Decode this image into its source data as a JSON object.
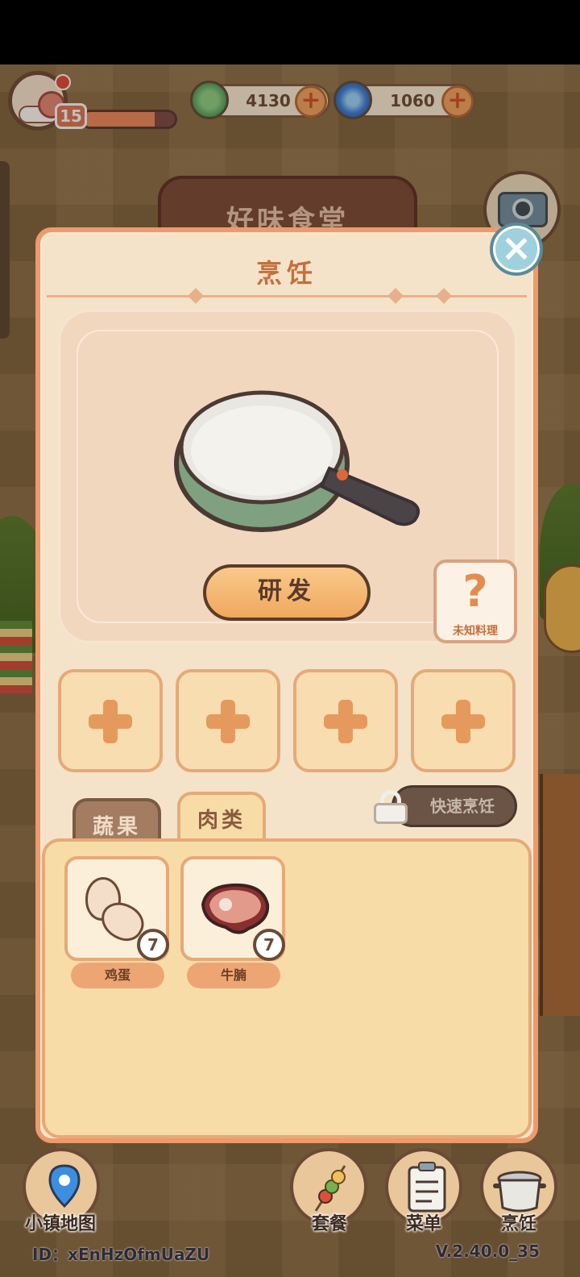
{
  "hud": {
    "level": "15",
    "xp_fraction": 0.78,
    "currencies": [
      {
        "name": "leaf-currency",
        "value": "4130"
      },
      {
        "name": "swirl-currency",
        "value": "1060"
      }
    ]
  },
  "restaurant_sign": "好味食堂",
  "panel": {
    "title": "烹饪",
    "research_button": "研发",
    "unknown_dish_label": "未知料理",
    "unknown_dish_symbol": "?",
    "slot_count": 4,
    "quick_cook_label": "快速烹饪",
    "tabs": [
      {
        "label": "蔬果",
        "active": false
      },
      {
        "label": "肉类",
        "active": true
      }
    ],
    "ingredients": [
      {
        "name": "鸡蛋",
        "count": "7",
        "icon": "egg-icon"
      },
      {
        "name": "牛腩",
        "count": "7",
        "icon": "beef-brisket-icon"
      }
    ]
  },
  "bottom_nav": {
    "map": "小镇地图",
    "set_meal": "套餐",
    "menu": "菜单",
    "cook": "烹饪"
  },
  "footer": {
    "id": "ID：xEnHzOfmUaZU",
    "version": "V.2.40.0_35"
  },
  "colors": {
    "panel_bg": "#f4e3c8",
    "panel_border": "#ee9a6a",
    "accent_orange": "#f0a85e",
    "title_text": "#c56f3d"
  }
}
